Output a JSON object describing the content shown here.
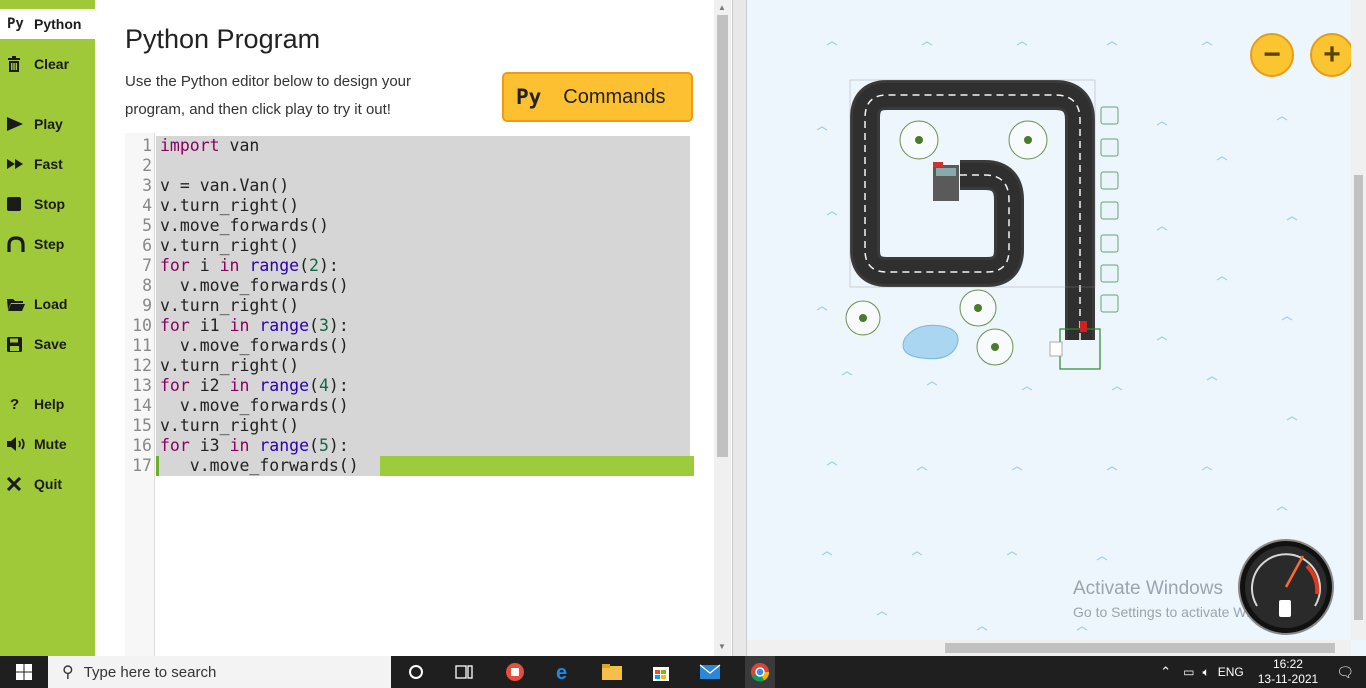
{
  "sidebar": {
    "items": [
      {
        "id": "python",
        "label": "Python",
        "icon": "Py"
      },
      {
        "id": "clear",
        "label": "Clear",
        "icon": "trash-icon"
      },
      {
        "id": "play",
        "label": "Play",
        "icon": "play-icon"
      },
      {
        "id": "fast",
        "label": "Fast",
        "icon": "fast-forward-icon"
      },
      {
        "id": "stop",
        "label": "Stop",
        "icon": "stop-icon"
      },
      {
        "id": "step",
        "label": "Step",
        "icon": "step-icon"
      },
      {
        "id": "load",
        "label": "Load",
        "icon": "folder-icon"
      },
      {
        "id": "save",
        "label": "Save",
        "icon": "save-icon"
      },
      {
        "id": "help",
        "label": "Help",
        "icon": "question-icon"
      },
      {
        "id": "mute",
        "label": "Mute",
        "icon": "speaker-icon"
      },
      {
        "id": "quit",
        "label": "Quit",
        "icon": "close-icon"
      }
    ]
  },
  "editor": {
    "title": "Python Program",
    "instructions": "Use the Python editor below to design your program, and then click play to try it out!",
    "commands_icon": "Py",
    "commands_label": "Commands",
    "lines": [
      {
        "n": "1",
        "text": "import van"
      },
      {
        "n": "2",
        "text": ""
      },
      {
        "n": "3",
        "text": "v = van.Van()"
      },
      {
        "n": "4",
        "text": "v.turn_right()"
      },
      {
        "n": "5",
        "text": "v.move_forwards()"
      },
      {
        "n": "6",
        "text": "v.turn_right()"
      },
      {
        "n": "7",
        "text": "for i in range(2):"
      },
      {
        "n": "8",
        "text": "  v.move_forwards()"
      },
      {
        "n": "9",
        "text": "v.turn_right()"
      },
      {
        "n": "10",
        "text": "for i1 in range(3):"
      },
      {
        "n": "11",
        "text": "  v.move_forwards()"
      },
      {
        "n": "12",
        "text": "v.turn_right()"
      },
      {
        "n": "13",
        "text": "for i2 in range(4):"
      },
      {
        "n": "14",
        "text": "  v.move_forwards()"
      },
      {
        "n": "15",
        "text": "v.turn_right()"
      },
      {
        "n": "16",
        "text": "for i3 in range(5):"
      },
      {
        "n": "17",
        "text": "   v.move_forwards()"
      }
    ],
    "current_line": "17"
  },
  "map": {
    "zoom_out": "−",
    "zoom_in": "+",
    "watermark_title": "Activate Windows",
    "watermark_sub": "Go to Settings to activate Windows.",
    "gauge_icon": "fuel-gauge-icon"
  },
  "taskbar": {
    "search_placeholder": "Type here to search",
    "tray_lang": "ENG",
    "time": "16:22",
    "date": "13-11-2021"
  },
  "colors": {
    "sidebar": "#a0c93a",
    "commands_button": "#fdc030",
    "current_line": "#9ccc3c",
    "code_bg": "#d6d6d6",
    "map_bg": "#eef6fd"
  }
}
